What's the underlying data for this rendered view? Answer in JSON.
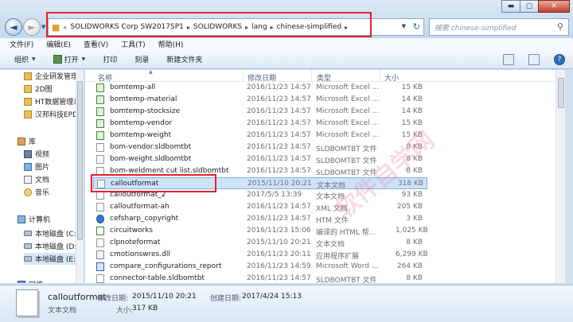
{
  "window": {
    "minimize_icon": "minimize-icon",
    "maximize_icon": "maximize-icon",
    "close_icon": "close-icon",
    "minimize_glyph": "▬",
    "maximize_glyph": "▢",
    "close_glyph": "✕"
  },
  "nav": {
    "back_glyph": "◄",
    "forward_glyph": "►",
    "dropdown_glyph": "▼"
  },
  "address": {
    "prefix": "«",
    "crumbs": [
      "SOLIDWORKS Corp SW2017SP1",
      "SOLIDWORKS",
      "lang",
      "chinese-simplified"
    ],
    "separator": "▸",
    "dropdown_glyph": "▼",
    "refresh_glyph": "↻",
    "highlight_color": "#e5222e"
  },
  "search": {
    "placeholder": "搜索 chinese-simplified",
    "icon_glyph": "⚲"
  },
  "menu": [
    "文件(F)",
    "编辑(E)",
    "查看(V)",
    "工具(T)",
    "帮助(H)"
  ],
  "toolbar": {
    "organize": "组织",
    "open": "打开",
    "print": "打印",
    "burn": "刻录",
    "new_folder": "新建文件夹",
    "dropdown_glyph": "▼",
    "help_glyph": "?"
  },
  "sidebar": {
    "items": [
      {
        "label": "企业研发管理",
        "icon": "folder-icon"
      },
      {
        "label": "2D图",
        "icon": "folder-icon"
      },
      {
        "label": "HT数据管理系",
        "icon": "folder-icon"
      },
      {
        "label": "汉邦科技EPDM",
        "icon": "folder-icon"
      },
      {
        "label": "库",
        "icon": "library-icon"
      },
      {
        "label": "视频",
        "icon": "video-icon"
      },
      {
        "label": "图片",
        "icon": "picture-icon"
      },
      {
        "label": "文档",
        "icon": "document-icon"
      },
      {
        "label": "音乐",
        "icon": "music-icon"
      },
      {
        "label": "计算机",
        "icon": "computer-icon"
      },
      {
        "label": "本地磁盘 (C:)",
        "icon": "drive-icon"
      },
      {
        "label": "本地磁盘 (D:)",
        "icon": "drive-icon"
      },
      {
        "label": "本地磁盘 (E:)",
        "icon": "drive-icon"
      },
      {
        "label": "网络",
        "icon": "network-icon"
      }
    ]
  },
  "columns": {
    "name": "名称",
    "modified": "修改日期",
    "type": "类型",
    "size": "大小",
    "sort_glyph": "▲"
  },
  "files": [
    {
      "name": "bomtemp-all",
      "date": "2016/11/23 14:57",
      "type": "Microsoft Excel ...",
      "size": "15 KB",
      "icon": "excel-icon"
    },
    {
      "name": "bomtemp-material",
      "date": "2016/11/23 14:57",
      "type": "Microsoft Excel ...",
      "size": "14 KB",
      "icon": "excel-icon"
    },
    {
      "name": "bomtemp-stocksize",
      "date": "2016/11/23 14:57",
      "type": "Microsoft Excel ...",
      "size": "14 KB",
      "icon": "excel-icon"
    },
    {
      "name": "bomtemp-vendor",
      "date": "2016/11/23 14:57",
      "type": "Microsoft Excel ...",
      "size": "15 KB",
      "icon": "excel-icon"
    },
    {
      "name": "bomtemp-weight",
      "date": "2016/11/23 14:57",
      "type": "Microsoft Excel ...",
      "size": "15 KB",
      "icon": "excel-icon"
    },
    {
      "name": "bom-vendor.sldbomtbt",
      "date": "2016/11/23 14:57",
      "type": "SLDBOMTBT 文件",
      "size": "8 KB",
      "icon": "file-icon"
    },
    {
      "name": "bom-weight.sldbomtbt",
      "date": "2016/11/23 14:57",
      "type": "SLDBOMTBT 文件",
      "size": "8 KB",
      "icon": "file-icon"
    },
    {
      "name": "bom-weldment cut list.sldbomtbt",
      "date": "2016/11/23 14:57",
      "type": "SLDBOMTBT 文件",
      "size": "8 KB",
      "icon": "file-icon"
    },
    {
      "name": "calloutformat",
      "date": "2015/11/10 20:21",
      "type": "文本文档",
      "size": "318 KB",
      "icon": "text-file-icon",
      "selected": true
    },
    {
      "name": "calloutformat_2",
      "date": "2017/5/5 13:39",
      "type": "文本文档",
      "size": "93 KB",
      "icon": "text-file-icon"
    },
    {
      "name": "calloutformat-ah",
      "date": "2016/11/23 14:57",
      "type": "XML 文档",
      "size": "205 KB",
      "icon": "file-icon"
    },
    {
      "name": "cefsharp_copyright",
      "date": "2016/11/23 14:57",
      "type": "HTM 文件",
      "size": "3 KB",
      "icon": "html-icon"
    },
    {
      "name": "circuitworks",
      "date": "2016/11/23 15:06",
      "type": "编译的 HTML 帮...",
      "size": "1,025 KB",
      "icon": "circuitworks-icon"
    },
    {
      "name": "clpnoteformat",
      "date": "2015/11/10 20:21",
      "type": "文本文档",
      "size": "8 KB",
      "icon": "text-file-icon"
    },
    {
      "name": "cmotionswres.dll",
      "date": "2016/11/23 20:11",
      "type": "应用程序扩展",
      "size": "6,299 KB",
      "icon": "dll-icon"
    },
    {
      "name": "compare_configurations_report",
      "date": "2016/11/23 14:59",
      "type": "Microsoft Word ...",
      "size": "264 KB",
      "icon": "word-icon"
    },
    {
      "name": "connector-table.sldbomtbt",
      "date": "2016/11/23 14:57",
      "type": "SLDBOMTBT 文件",
      "size": "8 KB",
      "icon": "file-icon"
    }
  ],
  "watermark": "软件自学网",
  "details": {
    "name": "calloutformat",
    "modified_label": "修改日期:",
    "modified": "2015/11/10 20:21",
    "created_label": "创建日期:",
    "created": "2017/4/24 15:13",
    "type": "文本文档",
    "size_label": "大小:",
    "size": "317 KB"
  }
}
